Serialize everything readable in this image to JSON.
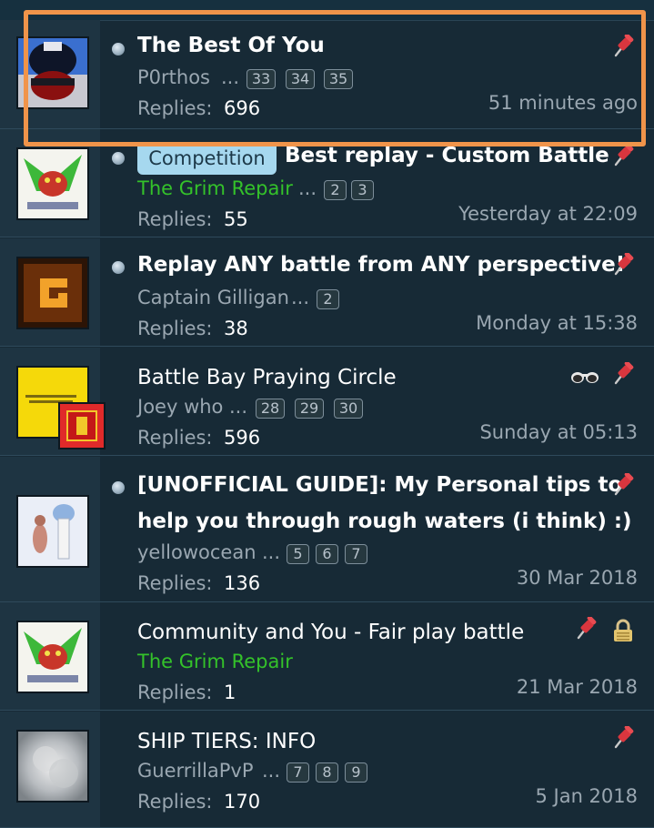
{
  "threads": [
    {
      "title": "The Best Of You",
      "author": "P0rthos",
      "dots": "...",
      "pages": [
        "33",
        "34",
        "35"
      ],
      "replies_label": "Replies:",
      "replies": "696",
      "date": "51 minutes ago"
    },
    {
      "prefix": "Competition",
      "title": "Best replay - Custom Battle",
      "author": "The Grim Repair",
      "dots": "...",
      "pages": [
        "2",
        "3"
      ],
      "replies_label": "Replies:",
      "replies": "55",
      "date": "Yesterday at 22:09"
    },
    {
      "title": "Replay ANY battle from ANY perspective!",
      "author": "Captain Gilligan",
      "dots": "...",
      "pages": [
        "2"
      ],
      "replies_label": "Replies:",
      "replies": "38",
      "date": "Monday at 15:38"
    },
    {
      "title": "Battle Bay Praying Circle",
      "author": "Joey who",
      "dots": "...",
      "pages": [
        "28",
        "29",
        "30"
      ],
      "replies_label": "Replies:",
      "replies": "596",
      "date": "Sunday at 05:13"
    },
    {
      "title_line1": "[UNOFFICIAL GUIDE]: My Personal tips to",
      "title_line2": "help you through rough waters (i think) :)",
      "author": "yellowocean",
      "dots": "...",
      "pages": [
        "5",
        "6",
        "7"
      ],
      "replies_label": "Replies:",
      "replies": "136",
      "date": "30 Mar 2018"
    },
    {
      "title": "Community and You - Fair play battle",
      "author": "The Grim Repair",
      "replies_label": "Replies:",
      "replies": "1",
      "date": "21 Mar 2018"
    },
    {
      "title": "SHIP TIERS: INFO",
      "author": "GuerrillaPvP",
      "dots": "...",
      "pages": [
        "7",
        "8",
        "9"
      ],
      "replies_label": "Replies:",
      "replies": "170",
      "date": "5 Jan 2018"
    }
  ],
  "icons": {
    "sticky": "pin-icon",
    "watched": "glasses-icon",
    "locked": "lock-icon",
    "unread": "unread-bullet-icon"
  },
  "colors": {
    "background": "#172a36",
    "highlight": "#f0944a",
    "author_green": "#34c22a",
    "prefix_bg": "#a6d8ef"
  }
}
